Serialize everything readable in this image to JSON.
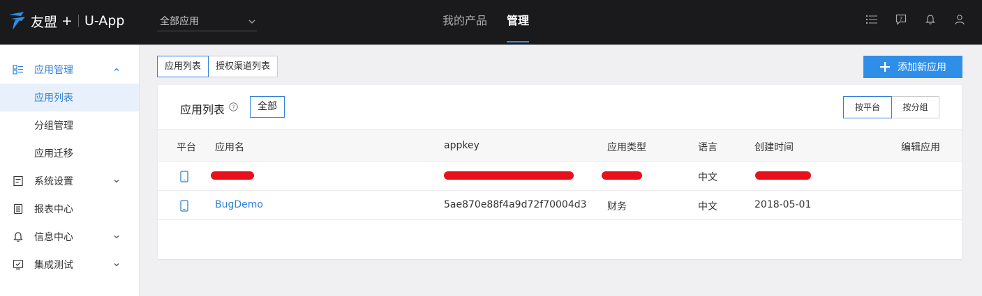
{
  "topbar": {
    "brand_name": "友盟",
    "brand_plus": "+",
    "app_name": "U-App",
    "app_select_value": "全部应用",
    "nav": [
      {
        "label": "我的产品",
        "active": false
      },
      {
        "label": "管理",
        "active": true
      }
    ],
    "icons": [
      "list-icon",
      "help-box-icon",
      "bell-icon",
      "user-icon"
    ]
  },
  "sidebar": {
    "items": [
      {
        "label": "应用管理",
        "icon": "grid-list-icon",
        "chevron": "up",
        "open": true
      },
      {
        "label": "应用列表",
        "sub": true,
        "selected": true
      },
      {
        "label": "分组管理",
        "sub": true
      },
      {
        "label": "应用迁移",
        "sub": true
      },
      {
        "label": "系统设置",
        "icon": "settings-doc-icon",
        "chevron": "down"
      },
      {
        "label": "报表中心",
        "icon": "report-icon"
      },
      {
        "label": "信息中心",
        "icon": "bell-icon",
        "chevron": "down"
      },
      {
        "label": "集成测试",
        "icon": "monitor-check-icon",
        "chevron": "down"
      }
    ]
  },
  "tabs": [
    {
      "label": "应用列表",
      "active": true
    },
    {
      "label": "授权渠道列表",
      "active": false
    }
  ],
  "add_button": {
    "label": "添加新应用"
  },
  "card": {
    "title": "应用列表",
    "filter_label": "全部",
    "group_buttons": [
      {
        "label": "按平台",
        "active": true
      },
      {
        "label": "按分组",
        "active": false
      }
    ]
  },
  "table": {
    "headers": {
      "platform": "平台",
      "name": "应用名",
      "appkey": "appkey",
      "type": "应用类型",
      "language": "语言",
      "created": "创建时间",
      "edit": "编辑应用"
    },
    "rows": [
      {
        "platform": "phone-icon",
        "name": "",
        "appkey": "",
        "type": "",
        "language": "中文",
        "created": "",
        "redacted": true
      },
      {
        "platform": "phone-icon",
        "name": "BugDemo",
        "appkey": "5ae870e88f4a9d72f70004d3",
        "type": "财务",
        "language": "中文",
        "created": "2018-05-01",
        "redacted": false
      }
    ]
  },
  "colors": {
    "topbar_bg": "#1a1a1c",
    "accent": "#2f8fe8",
    "link": "#2f7fd8",
    "redaction": "#e8101a"
  }
}
